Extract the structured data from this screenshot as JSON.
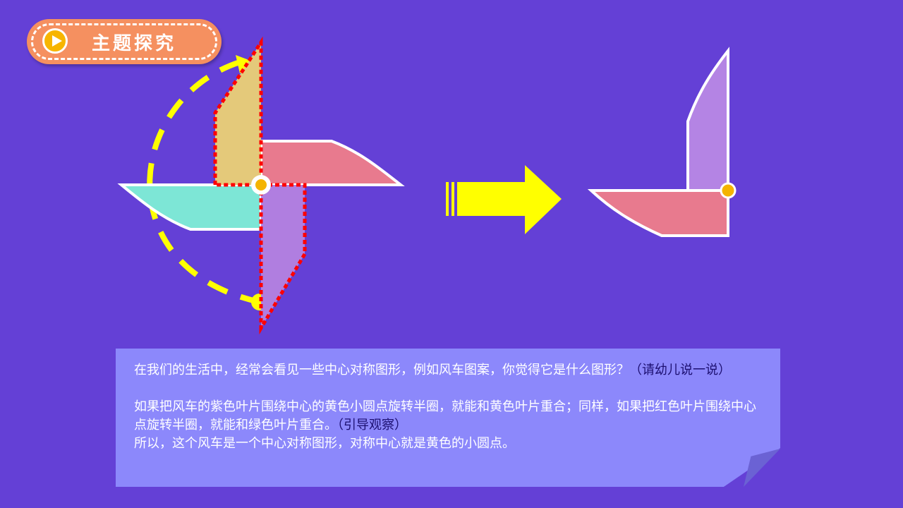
{
  "header": {
    "title": "主题探究",
    "icon": "play-icon"
  },
  "note": {
    "p1": "在我们的生活中，经常会看见一些中心对称图形，例如风车图案，你觉得它是什么图形？",
    "p1_hint": "（请幼儿说一说）",
    "p2": "如果把风车的紫色叶片围绕中心的黄色小圆点旋转半圈，就能和黄色叶片重合；同样，如果把红色叶片围绕中心点旋转半圈，就能和绿色叶片重合。",
    "p2_hint": "（引导观察）",
    "p3": "所以，这个风车是一个中心对称图形，对称中心就是黄色的小圆点。"
  },
  "colors": {
    "background": "#6440d6",
    "badge": "#f59060",
    "arrow": "#ffff00",
    "dashed": "#ff0000"
  }
}
